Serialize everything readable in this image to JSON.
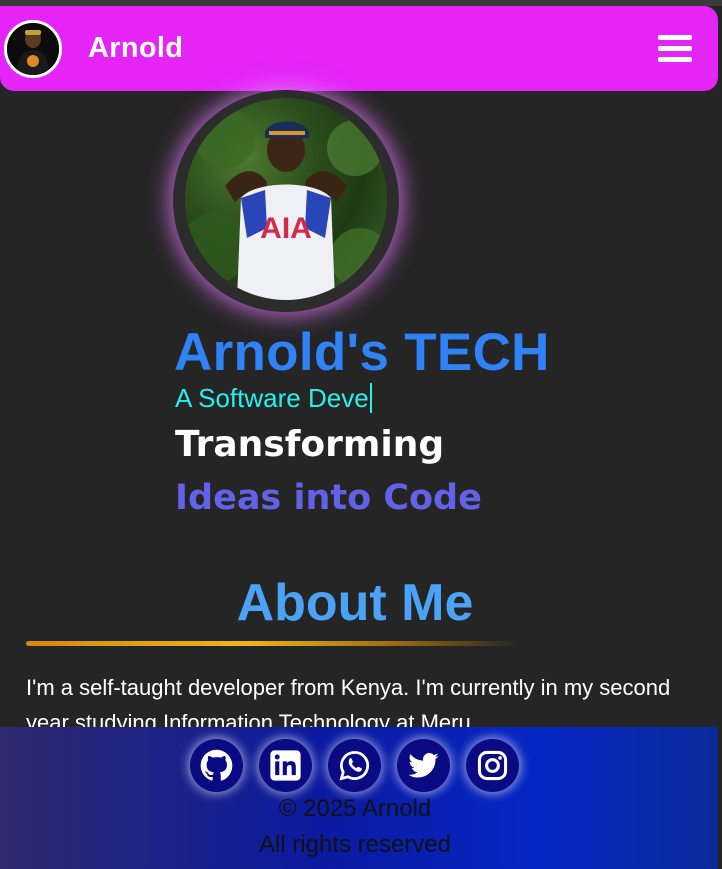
{
  "navbar": {
    "title": "Arnold",
    "menu_icon": "hamburger-menu-icon",
    "avatar_icon": "avatar"
  },
  "hero": {
    "brand": "Arnold's TECH",
    "typed_text": "A Software Deve",
    "tagline_line1": "Transforming",
    "tagline_line2": "Ideas into Code"
  },
  "about": {
    "title": "About Me",
    "text": "I'm a self-taught developer from Kenya. I'm currently in my second year studying Information Technology at Meru"
  },
  "footer": {
    "socials": [
      {
        "icon": "github-icon"
      },
      {
        "icon": "linkedin-icon"
      },
      {
        "icon": "whatsapp-icon"
      },
      {
        "icon": "twitter-icon"
      },
      {
        "icon": "instagram-icon"
      }
    ],
    "copyright": "© 2025 Arnold",
    "rights": "All rights reserved"
  },
  "colors": {
    "navbar": "#e524f8",
    "brand": "#2f83f6",
    "typed": "#27f0ea",
    "tagline2": "#6262e8",
    "about_title": "#4ba3f7",
    "background": "#252525"
  }
}
